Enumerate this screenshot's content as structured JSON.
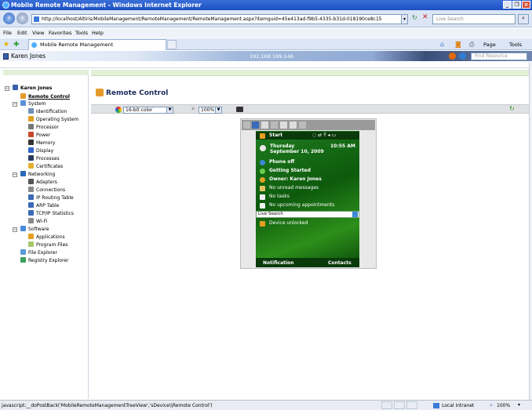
{
  "window": {
    "title": "Mobile Remote Management - Windows Internet Explorer"
  },
  "address": {
    "url": "http://localhost/Altiris/MobileManagement/RemoteManagement/RemoteManagement.aspx?itemguid=45e413ad-f9b5-4335-b31d-018190ce8c15",
    "search_placeholder": "Live Search"
  },
  "menu": [
    "File",
    "Edit",
    "View",
    "Favorites",
    "Tools",
    "Help"
  ],
  "tab": {
    "label": "Mobile Remote Management"
  },
  "cmdbar": {
    "page": "Page",
    "tools": "Tools"
  },
  "app": {
    "user": "Karen Jones",
    "ip": "192.168.189.146",
    "find_placeholder": "Find Resource"
  },
  "tree": {
    "root": "Karen Jones",
    "remote_control": "Remote Control",
    "system": "System",
    "system_items": [
      "Identification",
      "Operating System",
      "Processor",
      "Power",
      "Memory",
      "Display",
      "Processes",
      "Certificates"
    ],
    "networking": "Networking",
    "networking_items": [
      "Adapters",
      "Connections",
      "IP Routing Table",
      "ARP Table",
      "TCP/IP Statistics",
      "Wi-Fi"
    ],
    "software": "Software",
    "software_items": [
      "Applications",
      "Program Files"
    ],
    "file_explorer": "File Explorer",
    "registry_explorer": "Registry Explorer"
  },
  "main": {
    "title": "Remote Control",
    "color_depth": "16-bit color",
    "zoom": "100%"
  },
  "device": {
    "start": "Start",
    "day": "Thursday",
    "date": "September 10, 2009",
    "time": "10:55 AM",
    "rows": [
      "Phone off",
      "Getting Started",
      "Owner: Karen Jones",
      "No unread messages",
      "No tasks",
      "No upcoming appointments"
    ],
    "live_search": "Live Search",
    "unlocked": "Device unlocked",
    "soft_left": "Notification",
    "soft_right": "Contacts"
  },
  "status": {
    "text": "javascript:__doPostBack('MobileRemoteManagementTreeView','sDevice\\\\Remote Control')",
    "zone": "Local intranet",
    "zoom": "100%"
  }
}
